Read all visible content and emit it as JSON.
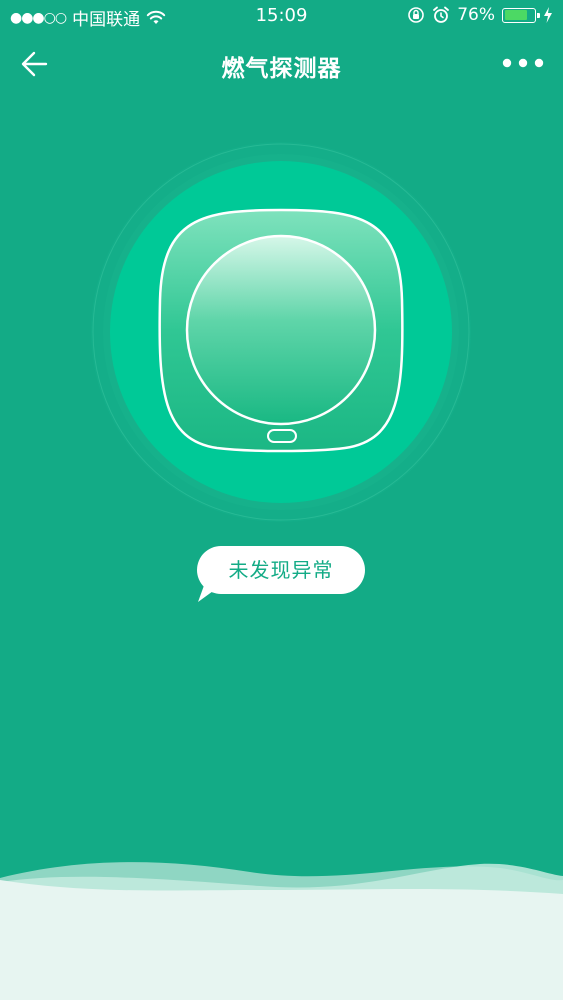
{
  "status_bar": {
    "signal": "●●●○○",
    "carrier": "中国联通",
    "time": "15:09",
    "battery_percent": "76%",
    "battery_level": 0.76,
    "battery_color": "#4cd964"
  },
  "nav": {
    "title": "燃气探测器",
    "back_icon": "arrow-left-icon",
    "more_icon": "more-dots-icon"
  },
  "device": {
    "status_text": "未发现异常"
  },
  "colors": {
    "background": "#13ab86",
    "ring": "#00c997",
    "wave_light": "#e7f5f1",
    "wave_mid": "#8fd6c3"
  }
}
